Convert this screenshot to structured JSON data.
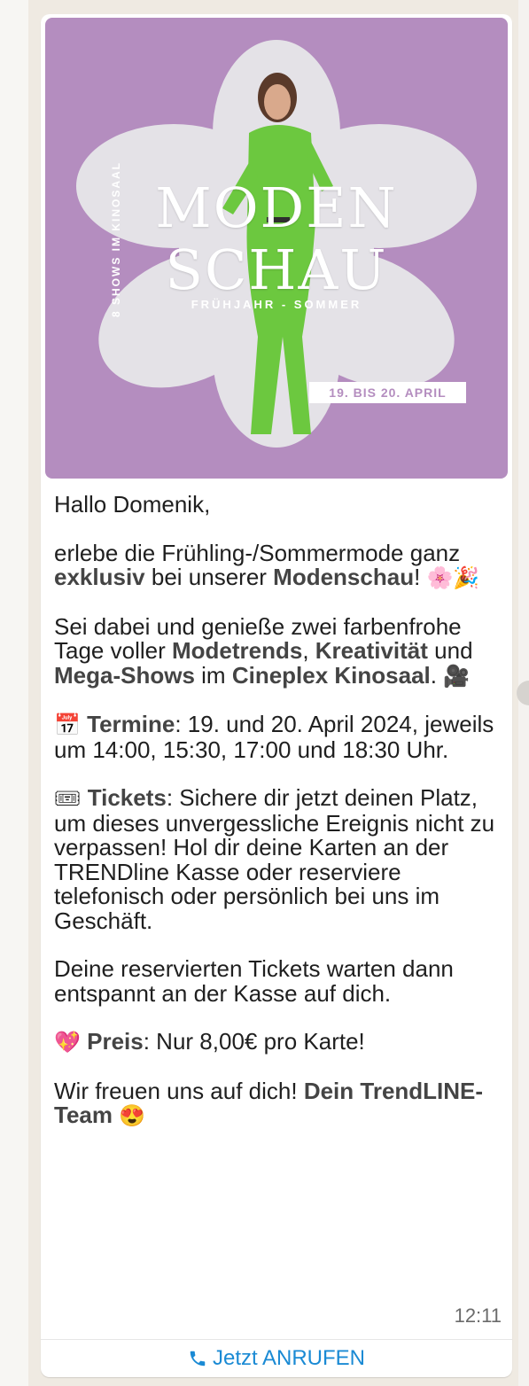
{
  "promo": {
    "title_line1": "MODEN",
    "title_line2": "SCHAU",
    "subtitle": "FRÜHJAHR - SOMMER",
    "side_text": "8 SHOWS IM KINOSAAL",
    "date_badge": "19. BIS 20. APRIL"
  },
  "message": {
    "greeting": "Hallo Domenik,",
    "p1_a": "erlebe die Frühling-/Sommermode ganz ",
    "p1_b": "exklusiv",
    "p1_c": " bei unserer ",
    "p1_d": "Modenschau",
    "p1_e": "! ",
    "p1_emoji": "🌸🎉",
    "p2_a": "Sei dabei und genieße zwei farbenfrohe Tage voller ",
    "p2_b": "Modetrends",
    "p2_c": ", ",
    "p2_d": "Kreativität",
    "p2_e": " und ",
    "p2_f": "Mega-Shows",
    "p2_g": " im ",
    "p2_h": "Cineplex Kinosaal",
    "p2_i": ". ",
    "p2_emoji": "🎥",
    "p3_emoji": "📅",
    "p3_bold": "Termine",
    "p3_text": ": 19. und 20. April 2024, jeweils um 14:00, 15:30, 17:00 und 18:30 Uhr.",
    "p4_emoji": "🎟",
    "p4_bold": "Tickets",
    "p4_text": ": Sichere dir jetzt deinen Platz, um dieses unvergessliche Ereignis nicht zu verpassen! Hol dir deine Karten an der TRENDline Kasse oder reserviere telefonisch oder persönlich bei uns im Geschäft.",
    "p5": "Deine reservierten Tickets warten dann entspannt an der Kasse auf dich.",
    "p6_emoji": "💖",
    "p6_bold": "Preis",
    "p6_text": ": Nur 8,00€ pro Karte!",
    "p7_a": "Wir freuen uns auf dich! ",
    "p7_bold": "Dein TrendLINE-Team",
    "p7_space": " ",
    "p7_emoji": "😍",
    "time": "12:11"
  },
  "action": {
    "call_label": "Jetzt ANRUFEN",
    "icon": "phone-icon"
  },
  "colors": {
    "promo_bg": "#b48dbf",
    "link_blue": "#1a8ad4",
    "dress_green": "#6cc83f"
  }
}
